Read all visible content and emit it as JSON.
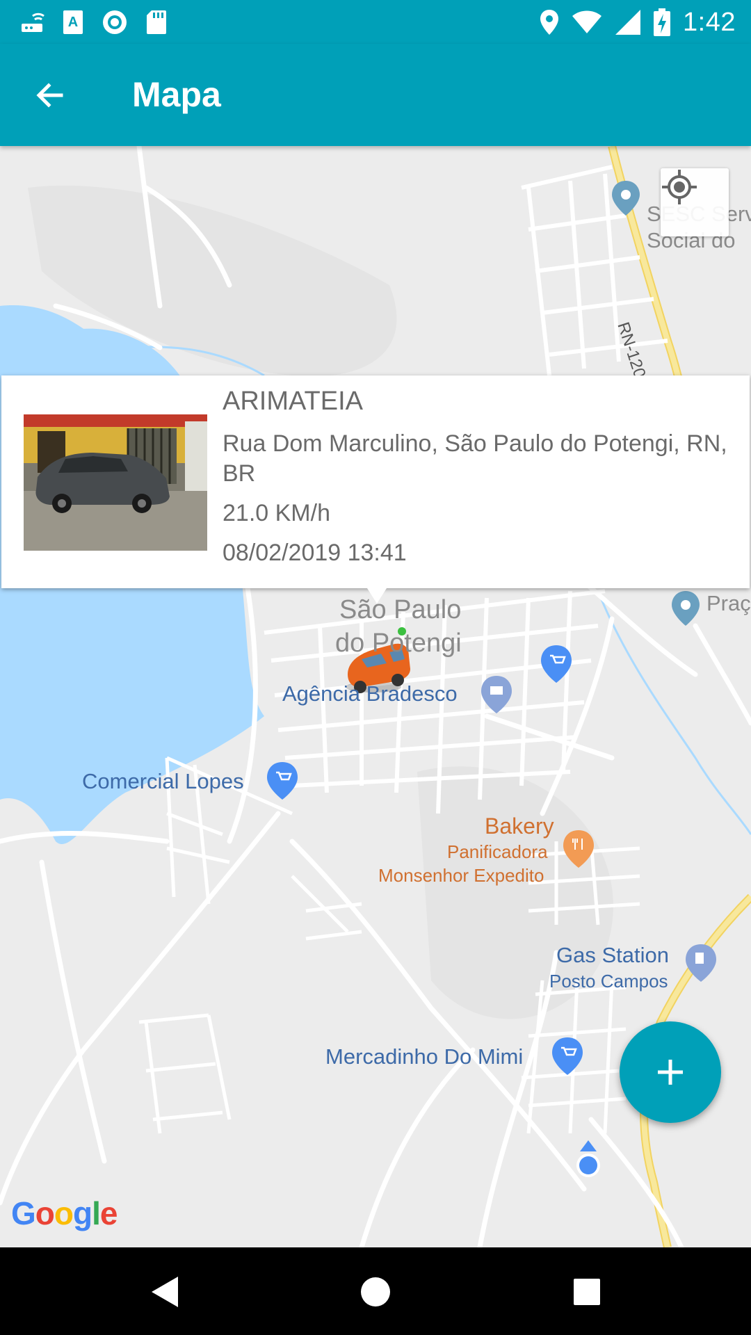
{
  "status_bar": {
    "time": "1:42",
    "icons": [
      "router-icon",
      "keyboard-a-icon",
      "record-icon",
      "sd-card-icon",
      "location-icon",
      "wifi-icon",
      "signal-icon",
      "battery-charging-icon"
    ]
  },
  "app_bar": {
    "title": "Mapa",
    "back_icon": "arrow-back-icon"
  },
  "map": {
    "labels": {
      "sesc": "SESC Serv",
      "sesc_line2": "Social do",
      "road_rn120": "RN-120",
      "praca": "Praç",
      "city": "São Paulo",
      "city_line2": "do Potengi",
      "bradesco": "Agência Bradesco",
      "comercial_lopes": "Comercial Lopes",
      "bakery": "Bakery",
      "panificadora": "Panificadora",
      "monsenhor": "Monsenhor Expedito",
      "gas_station": "Gas Station",
      "posto_campos": "Posto Campos",
      "mercadinho": "Mercadinho Do Mimi"
    },
    "logo": "Google",
    "colors": {
      "water": "#aadaff",
      "roads": "#ffffff",
      "highway": "#f8e27c",
      "poi_blue": "#4a8ff5"
    }
  },
  "info_window": {
    "name": "ARIMATEIA",
    "address": "Rua Dom Marculino, São Paulo do Potengi, RN, BR",
    "speed": "21.0 KM/h",
    "datetime": "08/02/2019 13:41"
  },
  "fab": {
    "icon": "plus-icon"
  },
  "nav_bar": {
    "icons": [
      "back-triangle-icon",
      "home-circle-icon",
      "recents-square-icon"
    ]
  }
}
